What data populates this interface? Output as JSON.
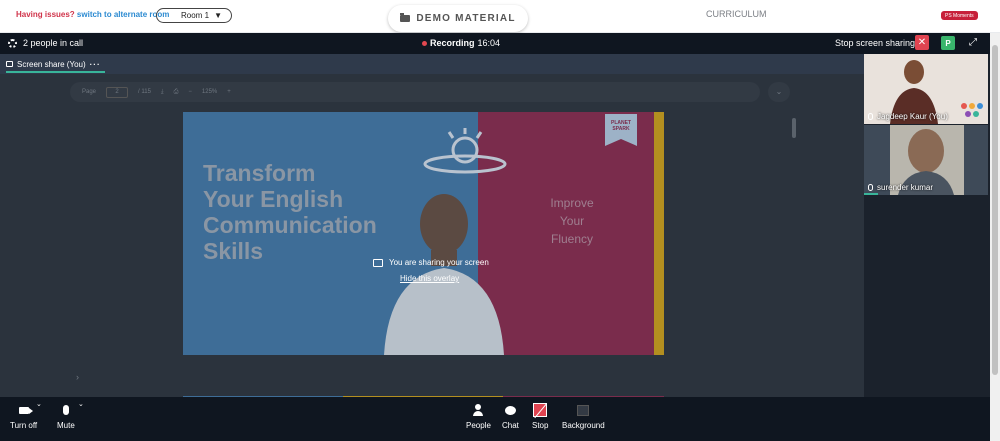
{
  "page": {
    "issues_question": "Having issues?",
    "issues_link": "switch to alternate room",
    "room_select": "Room 1",
    "demo_material": "DEMO MATERIAL",
    "curriculum": "CURRICULUM",
    "moments_badge": "PS Moments"
  },
  "call": {
    "people_count": "2 people in call",
    "recording_label": "Recording",
    "recording_time": "16:04",
    "stop_sharing": "Stop screen sharing",
    "p_button": "P",
    "tab_label": "Screen share (You)",
    "tab_more": "···"
  },
  "pdf": {
    "page_label": "Page",
    "page_number": "2",
    "page_total": "/ 115",
    "zoom": "125%"
  },
  "slide": {
    "headline": "Transform\nYour English\nCommunication\nSkills",
    "tagline": "Improve\nYour\nFluency",
    "logo": "PLANET SPARK"
  },
  "overlay": {
    "message": "You are sharing your screen",
    "hide": "Hide this overlay"
  },
  "participants": [
    {
      "name": "Jagdeep Kaur (You)"
    },
    {
      "name": "surender kumar"
    }
  ],
  "controls": {
    "turn_off": "Turn off",
    "mute": "Mute",
    "people": "People",
    "chat": "Chat",
    "stop": "Stop",
    "background": "Background"
  },
  "colors": {
    "accent_green": "#39b59a",
    "stop_red": "#e04451",
    "recording_red": "#e34850"
  }
}
